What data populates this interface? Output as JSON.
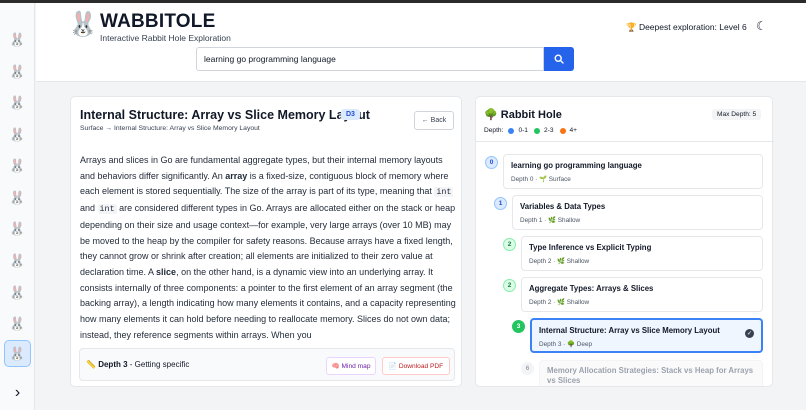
{
  "app": {
    "title": "WABBITOLE",
    "subtitle": "Interactive Rabbit Hole Exploration",
    "deepest_exploration": "🏆 Deepest exploration: Level 6"
  },
  "search": {
    "value": "learning go programming language"
  },
  "sidebar_icon": "rabbit-icon",
  "document": {
    "title": "Internal Structure: Array vs Slice Memory Layout",
    "depth_badge": "D3",
    "breadcrumb": "Surface → Internal Structure: Array vs Slice Memory Layout",
    "back_label": "← Back",
    "paragraph": {
      "t1": "Arrays and slices in Go are fundamental aggregate types, but their internal memory layouts and behaviors differ significantly. An ",
      "b1": "array",
      "t2": " is a fixed-size, contiguous block of memory where each element is stored sequentially. The size of the array is part of its type, meaning that ",
      "c1": "int",
      "t3": " and ",
      "c2": "int",
      "t4": " are considered different types in Go. Arrays are allocated either on the stack or heap depending on their size and usage context—for example, very large arrays (over 10 MB) may be moved to the heap by the compiler for safety reasons. Because arrays have a fixed length, they cannot grow or shrink after creation; all elements are initialized to their zero value at declaration time. A ",
      "b2": "slice",
      "t5": ", on the other hand, is a dynamic view into an underlying array. It consists internally of three components: a pointer to the first element of an array segment (the backing array), a length indicating how many elements it contains, and a capacity representing how many elements it can hold before needing to reallocate memory. Slices do not own data; instead, they reference segments within arrays. When you"
    },
    "footer": {
      "depth_label": "Depth 3",
      "depth_desc": " - Getting specific",
      "mindmap_label": "🧠 Mind map",
      "pdf_label": "📄 Download PDF"
    }
  },
  "rabbit_hole": {
    "title": "🌳 Rabbit Hole",
    "max_depth": "Max Depth: 5",
    "legend": {
      "label": "Depth:",
      "items": [
        {
          "label": "0-1",
          "color": "#3b82f6"
        },
        {
          "label": "2-3",
          "color": "#22c55e"
        },
        {
          "label": "4+",
          "color": "#f97316"
        }
      ]
    },
    "nodes": [
      {
        "num": "0",
        "title": "learning go programming language",
        "meta": "Depth 0 · 🌱 Surface",
        "circle_bg": "#dbeafe",
        "circle_fg": "#1d4ed8"
      },
      {
        "num": "1",
        "title": "Variables & Data Types",
        "meta": "Depth 1 · 🌿 Shallow",
        "circle_bg": "#dbeafe",
        "circle_fg": "#1d4ed8"
      },
      {
        "num": "2",
        "title": "Type Inference vs Explicit Typing",
        "meta": "Depth 2 · 🌿 Shallow",
        "circle_bg": "#dcfce7",
        "circle_fg": "#15803d"
      },
      {
        "num": "2",
        "title": "Aggregate Types: Arrays & Slices",
        "meta": "Depth 2 · 🌿 Shallow",
        "circle_bg": "#dcfce7",
        "circle_fg": "#15803d"
      },
      {
        "num": "3",
        "title": "Internal Structure: Array vs Slice Memory Layout",
        "meta": "Depth 3 · 🌳 Deep",
        "circle_bg": "#22c55e",
        "circle_fg": "#ffffff"
      },
      {
        "num": "6",
        "title": "Memory Allocation Strategies: Stack vs Heap for Arrays vs Slices",
        "meta": "",
        "circle_bg": "#f3f4f6",
        "circle_fg": "#9ca3af"
      }
    ]
  }
}
